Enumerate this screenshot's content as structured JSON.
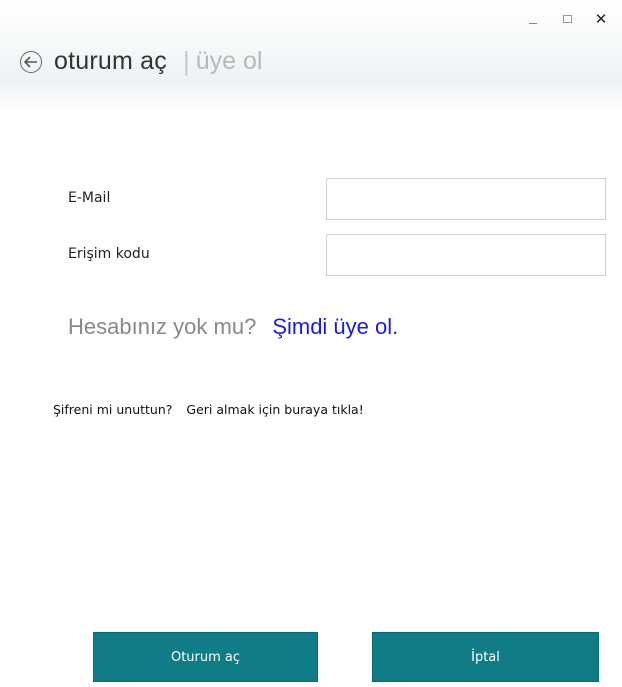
{
  "window": {
    "minimize_icon": "minimize-icon",
    "maximize_icon": "maximize-icon",
    "close_glyph": "✕"
  },
  "header": {
    "back_icon": "back-arrow-icon",
    "active_tab": "oturum aç",
    "separator": "|",
    "inactive_tab": "üye ol"
  },
  "form": {
    "email_label": "E-Mail",
    "email_value": "",
    "code_label": "Erişim kodu",
    "code_value": ""
  },
  "signup": {
    "question": "Hesabınız yok mu?",
    "link": "Şimdi üye ol."
  },
  "forgot": {
    "question": "Şifreni mi unuttun?",
    "link": "Geri almak için buraya tıkla!"
  },
  "buttons": {
    "login": "Oturum aç",
    "cancel": "İptal"
  },
  "colors": {
    "accent": "#0f7c86",
    "link": "#1a1ae6"
  }
}
